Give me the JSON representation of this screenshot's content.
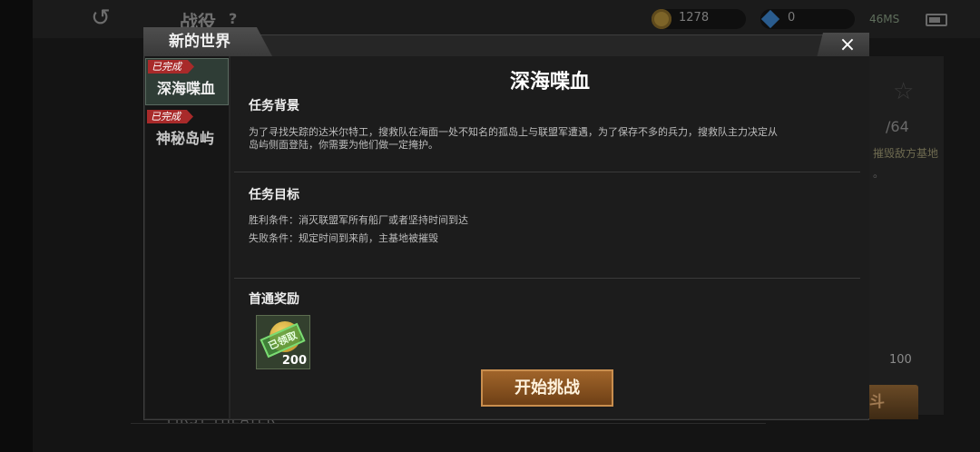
{
  "topbar": {
    "page_title": "战役",
    "help_label": "?",
    "coins": "1278",
    "gems": "0",
    "ping": "46MS"
  },
  "background": {
    "progress_count": "/64",
    "objective_hint": "摧毁敌方基地",
    "objective_dot": "。",
    "cost": "100",
    "fight_button": "斗",
    "theater_label": "FIRST THEATER"
  },
  "modal": {
    "world_tab": "新的世界",
    "close_label": "×",
    "levels": [
      {
        "badge": "已完成",
        "name": "深海喋血"
      },
      {
        "badge": "已完成",
        "name": "神秘岛屿"
      }
    ],
    "title": "深海喋血",
    "background_heading": "任务背景",
    "background_text_1": "为了寻找失踪的达米尔特工，搜救队在海面一处不知名的孤岛上与联盟军遭遇，为了保存不多的兵力，搜救队主力决定从",
    "background_text_2": "岛屿侧面登陆，你需要为他们做一定掩护。",
    "objective_heading": "任务目标",
    "win_condition": "胜利条件：消灭联盟军所有船厂或者坚持时间到达",
    "lose_condition": "失败条件：规定时间到来前，主基地被摧毁",
    "reward_heading": "首通奖励",
    "reward_stamp": "已领取",
    "reward_amount": "200",
    "start_button": "开始挑战"
  },
  "colors": {
    "accent_button": "#8a5222",
    "badge_red": "#a82a2a",
    "active_level": "#2f3d36"
  }
}
